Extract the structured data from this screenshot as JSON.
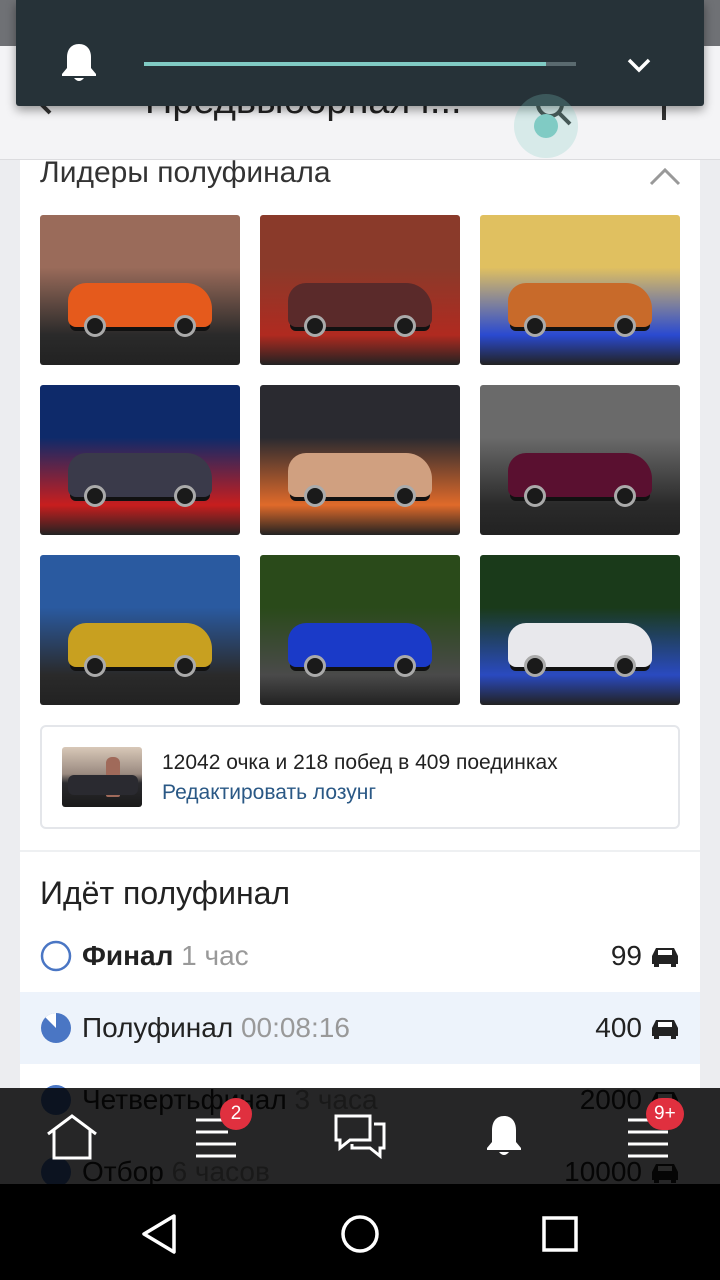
{
  "header": {
    "title": "Предвыборная г..."
  },
  "volume": {
    "level": 0.93
  },
  "leaders": {
    "title": "Лидеры полуфинала",
    "photos": [
      {
        "name": "photo-orange-lada",
        "colors": [
          "#9a6b5a",
          "#e55a1c",
          "#2a2a2a"
        ]
      },
      {
        "name": "photo-red-sedan-autumn",
        "colors": [
          "#8a3a2a",
          "#5a2a2a",
          "#b02a20"
        ]
      },
      {
        "name": "photo-blue-coupe-autumn",
        "colors": [
          "#e0c060",
          "#c86a2a",
          "#2a4ad0"
        ]
      },
      {
        "name": "photo-red-audi-night",
        "colors": [
          "#0e2a6a",
          "#3a3a4a",
          "#c81e1e"
        ]
      },
      {
        "name": "photo-orange-sedan-lights",
        "colors": [
          "#2a2a30",
          "#d0a080",
          "#e06a2a"
        ]
      },
      {
        "name": "photo-maroon-golf",
        "colors": [
          "#6a6a6a",
          "#5a1030",
          "#2a2a2a"
        ]
      },
      {
        "name": "photo-yellow-sedan",
        "colors": [
          "#2a5aa0",
          "#c8a020",
          "#2a2a2a"
        ]
      },
      {
        "name": "photo-blue-subaru-road",
        "colors": [
          "#2a4a1a",
          "#1a3ac8",
          "#4a4a4a"
        ]
      },
      {
        "name": "photo-blue-drift-smoke",
        "colors": [
          "#1a3a1a",
          "#e8e8ec",
          "#2a4ac0"
        ]
      }
    ]
  },
  "slogan": {
    "stats": "12042 очка и 218 побед в 409 поединках",
    "edit_label": "Редактировать лозунг"
  },
  "stages": {
    "title": "Идёт полуфинал",
    "rows": [
      {
        "name": "Финал",
        "time": "1 час",
        "count": "99",
        "state": "upcoming",
        "bold": true
      },
      {
        "name": "Полуфинал",
        "time": "00:08:16",
        "count": "400",
        "state": "active",
        "bold": false
      },
      {
        "name": "Четвертьфинал",
        "time": "3 часа",
        "count": "2000",
        "state": "done",
        "bold": false
      },
      {
        "name": "Отбор",
        "time": "6 часов",
        "count": "10000",
        "state": "done",
        "bold": false
      }
    ]
  },
  "tabs": {
    "feed_badge": "2",
    "menu_badge": "9+"
  },
  "colors": {
    "accent_blue": "#4a76c4",
    "link_blue": "#2a5885",
    "badge_red": "#e0303f",
    "teal": "#80cbc4"
  }
}
